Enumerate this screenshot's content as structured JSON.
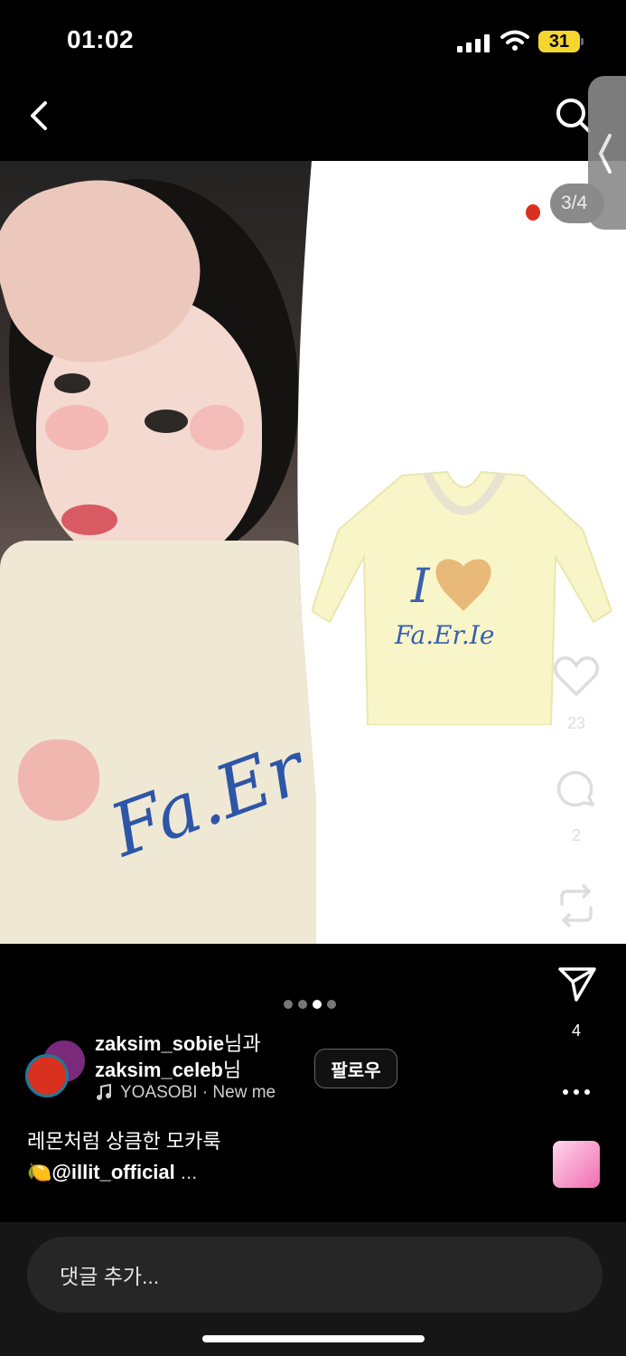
{
  "status_bar": {
    "time": "01:02",
    "battery": "31"
  },
  "media": {
    "counter": "3/4",
    "product_text_line1": "I",
    "product_text_line2": "Fa.Er.Ie",
    "shirt_text": "Fa.Er",
    "page_count": 4,
    "active_page": 3
  },
  "actions": {
    "likes": "23",
    "comments": "2",
    "shares": "4"
  },
  "author": {
    "line1_name": "zaksim_sobie",
    "line1_suffix": "님과",
    "line2_name": "zaksim_celeb",
    "line2_suffix": "님",
    "music": "YOASOBI · New me",
    "follow_label": "팔로우"
  },
  "caption": {
    "line1": "레몬처럼 상큼한 모카룩",
    "emoji": "🍋",
    "mention": "@illit_official",
    "more": " ..."
  },
  "comment": {
    "placeholder": "댓글 추가..."
  },
  "colors": {
    "accent_battery": "#f5d630",
    "avatar_red": "#d9311f"
  }
}
